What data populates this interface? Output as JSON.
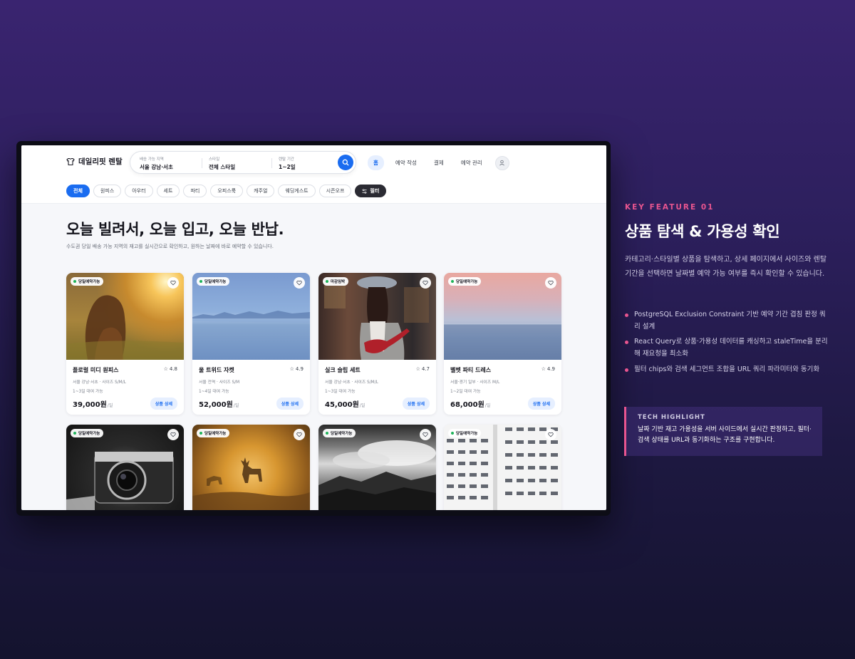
{
  "app": {
    "brand": "데일리핏 렌탈",
    "search": {
      "location_label": "배송 가능 지역",
      "location_value": "서울 강남·서초",
      "style_label": "스타일",
      "style_value": "전체 스타일",
      "period_label": "렌탈 기간",
      "period_value": "1~2일"
    },
    "nav": [
      "홈",
      "예약 작성",
      "결제",
      "예약 관리"
    ],
    "chips": [
      "전체",
      "원피스",
      "아우터",
      "세트",
      "파티",
      "오피스룩",
      "캐주얼",
      "웨딩게스트",
      "시즌오프"
    ],
    "filter_label": "필터",
    "hero": {
      "title": "오늘 빌려서, 오늘 입고, 오늘 반납.",
      "subtitle": "수도권 당일 배송 가능 지역의 재고를 실시간으로 확인하고, 원하는 날짜에 바로 예약할 수 있습니다."
    },
    "cards": [
      {
        "badge": "당일예약가능",
        "name": "플로럴 미디 원피스",
        "rating": "4.8",
        "meta": "서울 강남·서초 · 사이즈 S/M/L",
        "period": "1~3일 대여 가능",
        "price": "39,000원",
        "unit": "/일",
        "cta": "상품 상세"
      },
      {
        "badge": "당일예약가능",
        "name": "울 트위드 자켓",
        "rating": "4.9",
        "meta": "서울 전역 · 사이즈 S/M",
        "period": "1~4일 대여 가능",
        "price": "52,000원",
        "unit": "/일",
        "cta": "상품 상세"
      },
      {
        "badge": "마감임박",
        "name": "실크 슬립 세트",
        "rating": "4.7",
        "meta": "서울 강남·서초 · 사이즈 S/M/L",
        "period": "1~3일 대여 가능",
        "price": "45,000원",
        "unit": "/일",
        "cta": "상품 상세"
      },
      {
        "badge": "당일예약가능",
        "name": "벨벳 파티 드레스",
        "rating": "4.9",
        "meta": "서울·경기 일부 · 사이즈 M/L",
        "period": "1~2일 대여 가능",
        "price": "68,000원",
        "unit": "/일",
        "cta": "상품 상세"
      },
      {
        "badge": "당일예약가능"
      },
      {
        "badge": "당일예약가능"
      },
      {
        "badge": "당일예약가능"
      },
      {
        "badge": "당일예약가능"
      }
    ]
  },
  "feature": {
    "label": "KEY FEATURE 01",
    "title": "상품 탐색 & 가용성 확인",
    "description": "카테고리·스타일별 상품을 탐색하고, 상세 페이지에서 사이즈와 렌탈 기간을 선택하면 날짜별 예약 가능 여부를 즉시 확인할 수 있습니다.",
    "bullets": [
      "PostgreSQL Exclusion Constraint 기반 예약 기간 겹침 판정 쿼리 설계",
      "React Query로 상품·가용성 데이터를 캐싱하고 staleTime을 분리해 재요청을 최소화",
      "필터 chips와 검색 세그먼트 조합을 URL 쿼리 파라미터와 동기화"
    ],
    "tech_title": "TECH HIGHLIGHT",
    "tech_text": "날짜 기반 재고 가용성을 서버 사이드에서 실시간 판정하고, 필터·검색 상태를 URL과 동기화하는 구조를 구현합니다."
  },
  "colors": {
    "accent": "#1a6cf0",
    "pink": "#e8558f",
    "available": "#1fb35a"
  }
}
